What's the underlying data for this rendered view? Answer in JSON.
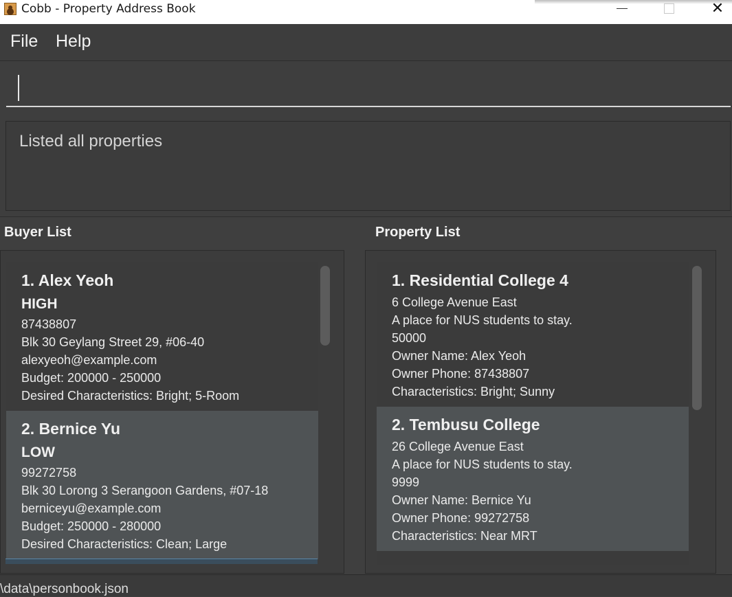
{
  "window": {
    "title": "Cobb - Property Address Book",
    "minimize_glyph": "",
    "close_glyph": "✕"
  },
  "menu": {
    "file": "File",
    "help": "Help"
  },
  "command": {
    "value": ""
  },
  "result": {
    "message": "Listed all properties"
  },
  "buyer_list": {
    "header": "Buyer List",
    "items": [
      {
        "title": "1.  Alex Yeoh",
        "priority": "HIGH",
        "phone": "87438807",
        "address": "Blk 30 Geylang Street 29, #06-40",
        "email": "alexyeoh@example.com",
        "budget": "Budget: 200000 - 250000",
        "characteristics": "Desired Characteristics: Bright; 5-Room"
      },
      {
        "title": "2.  Bernice Yu",
        "priority": "LOW",
        "phone": "99272758",
        "address": "Blk 30 Lorong 3 Serangoon Gardens, #07-18",
        "email": "berniceyu@example.com",
        "budget": "Budget: 250000 - 280000",
        "characteristics": "Desired Characteristics: Clean; Large"
      }
    ]
  },
  "property_list": {
    "header": "Property List",
    "items": [
      {
        "title": "1.  Residential College 4",
        "address": "6 College Avenue East",
        "description": "A place for NUS students to stay.",
        "price": "50000",
        "owner_name": "Owner Name: Alex Yeoh",
        "owner_phone": "Owner Phone: 87438807",
        "characteristics": "Characteristics: Bright; Sunny"
      },
      {
        "title": "2.  Tembusu College",
        "address": "26 College Avenue East",
        "description": "A place for NUS students to stay.",
        "price": "9999",
        "owner_name": "Owner Name: Bernice Yu",
        "owner_phone": "Owner Phone: 99272758",
        "characteristics": "Characteristics: Near MRT"
      }
    ]
  },
  "status": {
    "path": "\\data\\personbook.json"
  }
}
